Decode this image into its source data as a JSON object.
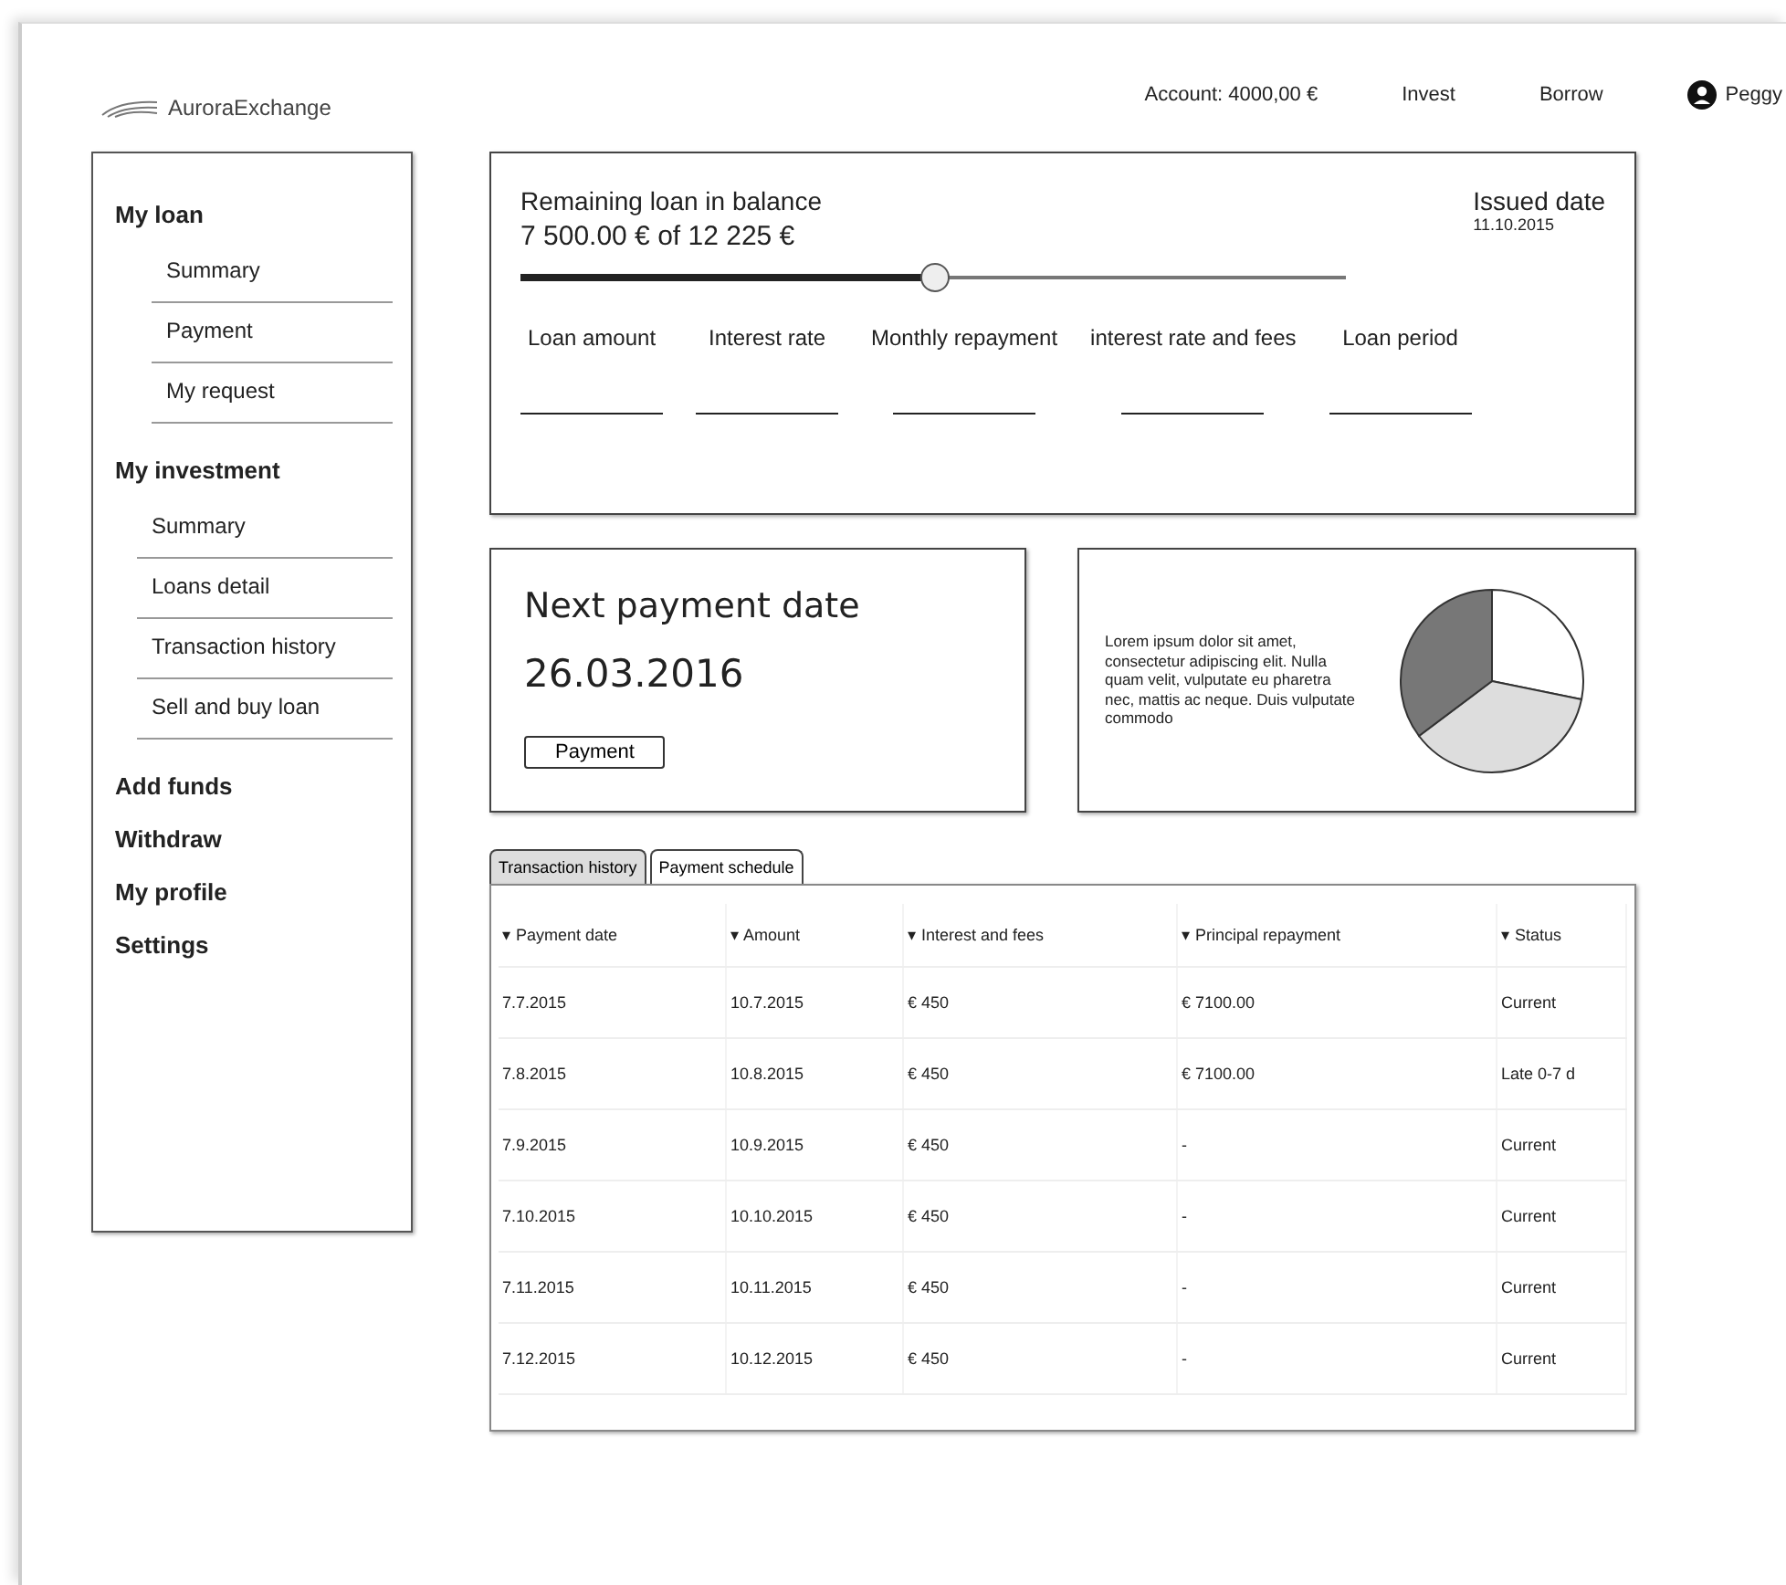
{
  "brand": "AuroraExchange",
  "header": {
    "account": "Account: 4000,00 €",
    "links": [
      "Invest",
      "Borrow"
    ],
    "user": "Peggy"
  },
  "sidebar": [
    {
      "label": "My loan",
      "children": [
        {
          "label": "Summary"
        },
        {
          "label": "Payment"
        },
        {
          "label": "My request"
        }
      ]
    },
    {
      "label": "My investment",
      "children": [
        {
          "label": "Summary"
        },
        {
          "label": "Loans detail"
        },
        {
          "label": "Transaction history"
        },
        {
          "label": "Sell and buy loan"
        }
      ]
    },
    {
      "label": "Add funds"
    },
    {
      "label": "Withdraw"
    },
    {
      "label": "My profile"
    },
    {
      "label": "Settings"
    }
  ],
  "loan": {
    "title": "Remaining loan in balance",
    "amount": "7 500.00 € of  12 225 €",
    "level": 0.5,
    "issued_label": "Issued date",
    "issued_date": "11.10.2015",
    "fields": [
      "Loan amount",
      "Interest rate",
      "Monthly repayment",
      "interest rate and fees",
      "Loan period"
    ]
  },
  "next_payment": {
    "title": "Next payment date",
    "date": "26.03.2016",
    "button": "Payment"
  },
  "info": {
    "text": "Lorem ipsum dolor sit amet, consectetur adipiscing elit. Nulla quam velit, vulputate eu pharetra nec, mattis ac neque. Duis vulputate commodo"
  },
  "tabs": [
    {
      "label": "Transaction history",
      "selected": false
    },
    {
      "label": "Payment schedule",
      "selected": true
    }
  ],
  "table": {
    "columns": [
      "▾ Payment date",
      "▾ Amount",
      "▾ Interest and fees",
      "▾ Principal repayment",
      "▾ Status"
    ],
    "rows": [
      [
        "7.7.2015",
        "10.7.2015",
        "€ 450",
        "€ 7100.00",
        "Current"
      ],
      [
        "7.8.2015",
        "10.8.2015",
        "€ 450",
        "€ 7100.00",
        "Late 0-7 d"
      ],
      [
        "7.9.2015",
        "10.9.2015",
        "€ 450",
        "-",
        "Current"
      ],
      [
        "7.10.2015",
        "10.10.2015",
        "€ 450",
        "-",
        "Current"
      ],
      [
        "7.11.2015",
        "10.11.2015",
        "€ 450",
        "-",
        "Current"
      ],
      [
        "7.12.2015",
        "10.12.2015",
        "€ 450",
        "-",
        "Current"
      ]
    ]
  }
}
